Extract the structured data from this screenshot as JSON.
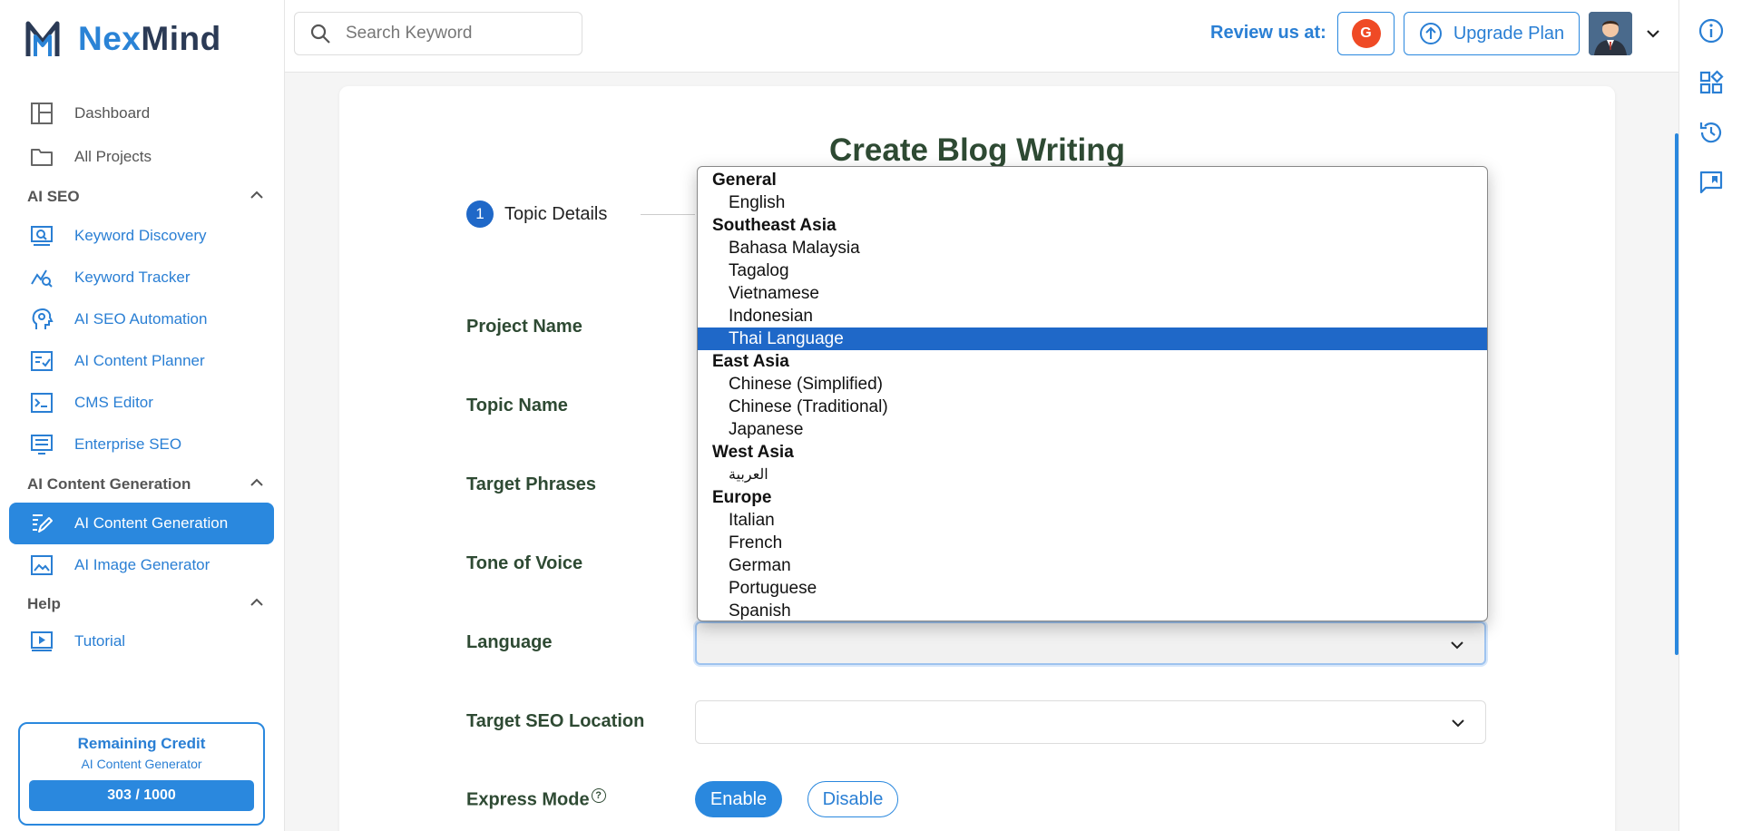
{
  "brand": {
    "part1": "Nex",
    "part2": "Mind"
  },
  "sidebar": {
    "items": [
      {
        "label": "Dashboard"
      },
      {
        "label": "All Projects"
      }
    ],
    "sections": [
      {
        "title": "AI SEO",
        "items": [
          {
            "label": "Keyword Discovery"
          },
          {
            "label": "Keyword Tracker"
          },
          {
            "label": "AI SEO Automation"
          },
          {
            "label": "AI Content Planner"
          },
          {
            "label": "CMS Editor"
          },
          {
            "label": "Enterprise SEO"
          }
        ]
      },
      {
        "title": "AI Content Generation",
        "items": [
          {
            "label": "AI Content Generation",
            "active": true
          },
          {
            "label": "AI Image Generator"
          }
        ]
      },
      {
        "title": "Help",
        "items": [
          {
            "label": "Tutorial"
          }
        ]
      }
    ],
    "credit": {
      "title": "Remaining Credit",
      "subtitle": "AI Content Generator",
      "value": "303 / 1000"
    }
  },
  "topbar": {
    "search_placeholder": "Search Keyword",
    "review_label": "Review us at:",
    "g2_label": "G",
    "upgrade_label": "Upgrade Plan"
  },
  "main": {
    "title": "Create Blog Writing",
    "step": {
      "number": "1",
      "label": "Topic Details"
    },
    "fields": [
      {
        "label": "Project Name"
      },
      {
        "label": "Topic Name"
      },
      {
        "label": "Target Phrases"
      },
      {
        "label": "Tone of Voice"
      },
      {
        "label": "Language"
      },
      {
        "label": "Target SEO Location"
      },
      {
        "label": "Express Mode"
      }
    ],
    "express_help": "?",
    "express_enable": "Enable",
    "express_disable": "Disable"
  },
  "language_dropdown": {
    "groups": [
      {
        "name": "General",
        "options": [
          "English"
        ]
      },
      {
        "name": "Southeast Asia",
        "options": [
          "Bahasa Malaysia",
          "Tagalog",
          "Vietnamese",
          "Indonesian",
          "Thai Language"
        ]
      },
      {
        "name": "East Asia",
        "options": [
          "Chinese (Simplified)",
          "Chinese (Traditional)",
          "Japanese"
        ]
      },
      {
        "name": "West Asia",
        "options": [
          "العربية"
        ]
      },
      {
        "name": "Europe",
        "options": [
          "Italian",
          "French",
          "German",
          "Portuguese",
          "Spanish"
        ]
      }
    ],
    "highlighted": "Thai Language"
  },
  "colors": {
    "accent": "#2a88de",
    "title_green": "#2e4a33",
    "selected": "#1f68c8"
  }
}
